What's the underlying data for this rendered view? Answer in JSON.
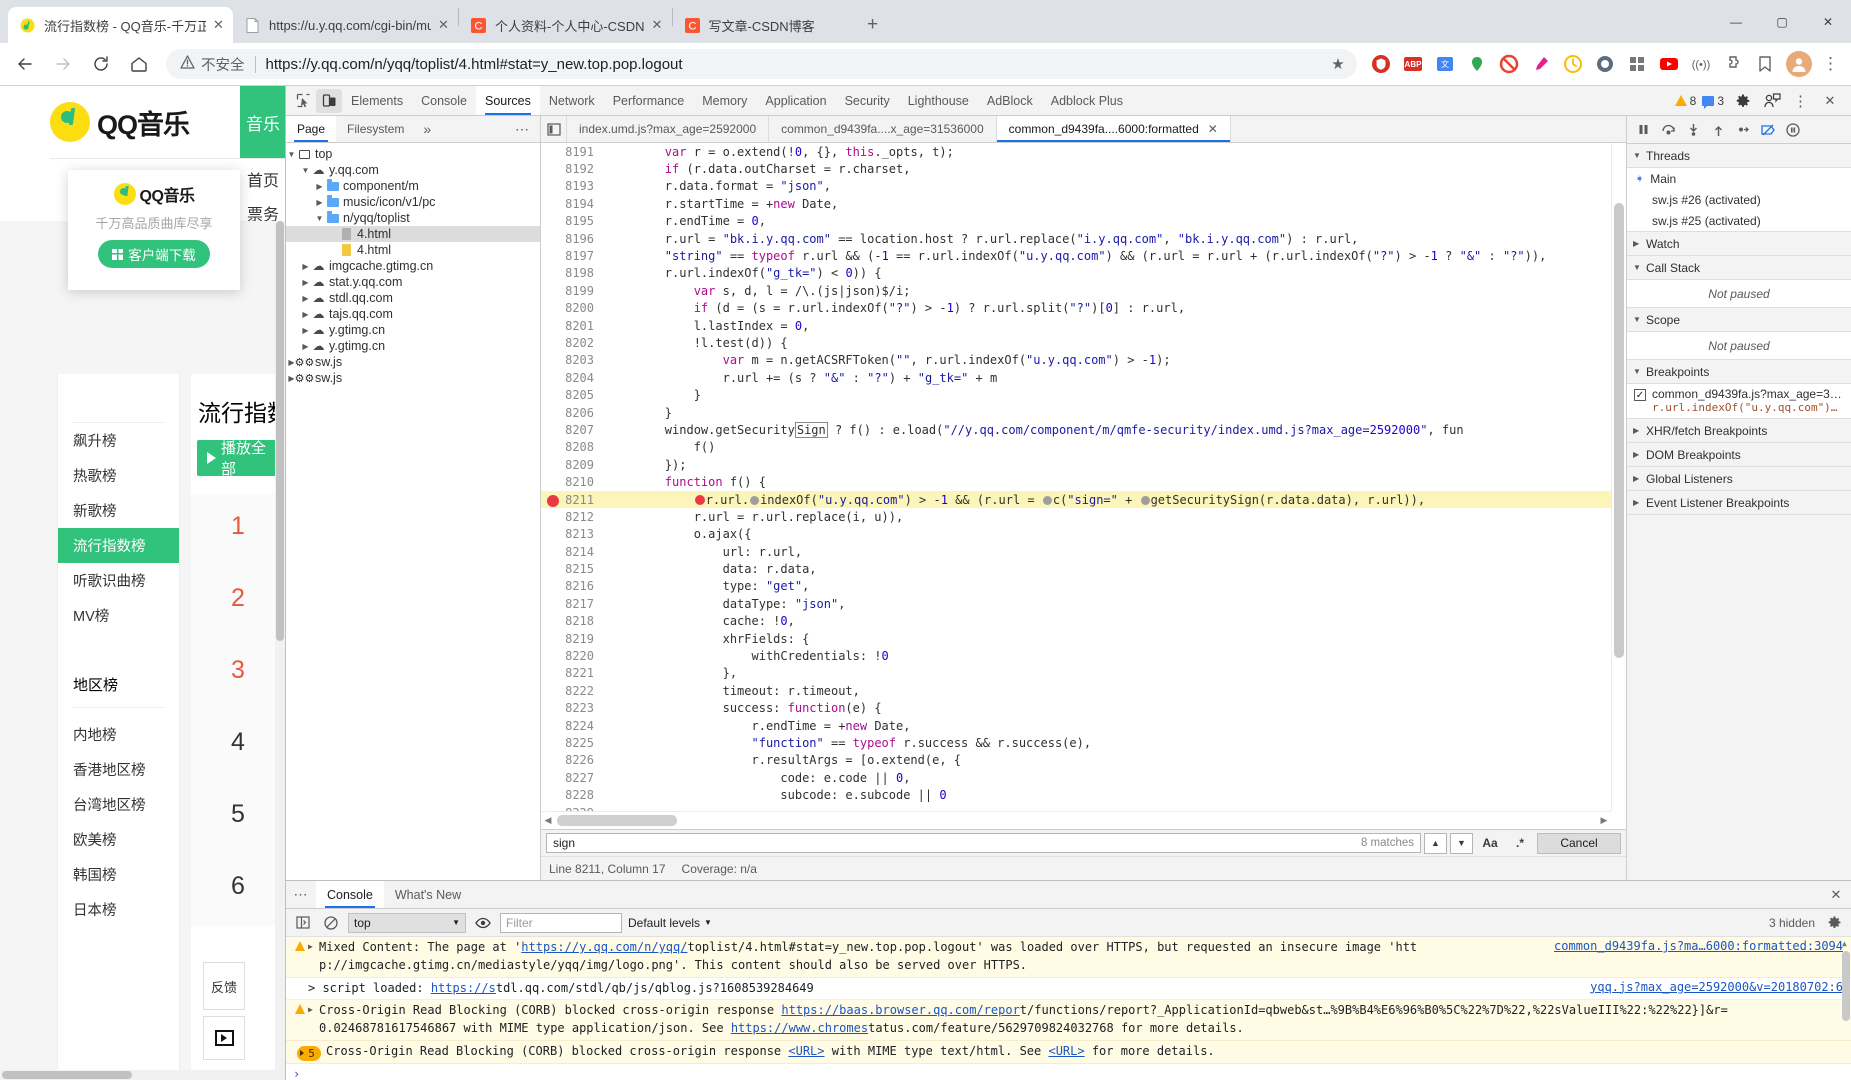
{
  "browser": {
    "tabs": [
      {
        "title": "流行指数榜 - QQ音乐-千万正版音",
        "favicon": "qq-music-icon",
        "active": true
      },
      {
        "title": "https://u.y.qq.com/cgi-bin/music",
        "favicon": "page-icon",
        "active": false
      },
      {
        "title": "个人资料-个人中心-CSDN",
        "favicon": "csdn-icon",
        "active": false
      },
      {
        "title": "写文章-CSDN博客",
        "favicon": "csdn-icon",
        "active": false
      }
    ],
    "new_tab_label": "+",
    "window_controls": {
      "minimize": "—",
      "maximize": "▢",
      "close": "✕"
    },
    "nav": {
      "back": "←",
      "forward": "→",
      "reload": "↻",
      "home": "⌂"
    },
    "omnibox": {
      "security_label": "不安全",
      "security_icon": "warning-triangle-icon",
      "url": "https://y.qq.com/n/yqq/toplist/4.html#stat=y_new.top.pop.logout",
      "star_icon": "★"
    },
    "extensions": [
      "shield-icon",
      "abp-icon",
      "translate-icon",
      "tracker-icon",
      "adblock-icon",
      "eyedropper-icon",
      "clock-icon",
      "grammar-icon",
      "grid-icon",
      "youtube-icon",
      "wifi-icon",
      "puzzle-icon",
      "bookmark-icon"
    ],
    "avatar": "user-avatar",
    "menu": "⋮"
  },
  "page": {
    "logo_text": "QQ音乐",
    "green_tab": "音乐",
    "nav_items": [
      "首页",
      "票务"
    ],
    "popup": {
      "logo_text": "QQ音乐",
      "tagline": "千万高品质曲库尽享",
      "button": "客户端下载"
    },
    "ranks_primary": [
      "飙升榜",
      "热歌榜",
      "新歌榜",
      "流行指数榜",
      "听歌识曲榜",
      "MV榜"
    ],
    "selected_rank": "流行指数榜",
    "ranks_region_title": "地区榜",
    "ranks_region": [
      "内地榜",
      "香港地区榜",
      "台湾地区榜",
      "欧美榜",
      "韩国榜",
      "日本榜"
    ],
    "list_title": "流行指数榜",
    "play_all": "播放全部",
    "song_numbers": [
      "1",
      "2",
      "3",
      "4",
      "5",
      "6"
    ],
    "feedback": "反馈",
    "player_icon": "play-box-icon"
  },
  "devtools": {
    "inspect_icon": "inspect-cursor-icon",
    "device_icon": "device-toggle-icon",
    "panels": [
      "Elements",
      "Console",
      "Sources",
      "Network",
      "Performance",
      "Memory",
      "Application",
      "Security",
      "Lighthouse",
      "AdBlock",
      "Adblock Plus"
    ],
    "active_panel": "Sources",
    "warning_count": "8",
    "message_count": "3",
    "settings_icon": "gear-icon",
    "feedback_icon": "person-feedback-icon",
    "more_icon": "⋮",
    "close_icon": "✕",
    "dock_icon": "dock-icon"
  },
  "navigator": {
    "tabs": [
      "Page",
      "Filesystem"
    ],
    "active_tab": "Page",
    "overflow": "»",
    "more": "⋯",
    "tree": [
      {
        "label": "top",
        "depth": 0,
        "icon": "frame-icon",
        "twisty": "▼",
        "selected": false
      },
      {
        "label": "y.qq.com",
        "depth": 1,
        "icon": "cloud-icon",
        "twisty": "▼",
        "selected": false
      },
      {
        "label": "component/m",
        "depth": 2,
        "icon": "folder-icon",
        "twisty": "▶",
        "selected": false
      },
      {
        "label": "music/icon/v1/pc",
        "depth": 2,
        "icon": "folder-icon",
        "twisty": "▶",
        "selected": false
      },
      {
        "label": "n/yqq/toplist",
        "depth": 2,
        "icon": "folder-icon",
        "twisty": "▼",
        "selected": false
      },
      {
        "label": "4.html",
        "depth": 3,
        "icon": "file-gray-icon",
        "twisty": "",
        "selected": true
      },
      {
        "label": "4.html",
        "depth": 3,
        "icon": "file-yellow-icon",
        "twisty": "",
        "selected": false
      },
      {
        "label": "imgcache.gtimg.cn",
        "depth": 1,
        "icon": "cloud-icon",
        "twisty": "▶",
        "selected": false
      },
      {
        "label": "stat.y.qq.com",
        "depth": 1,
        "icon": "cloud-icon",
        "twisty": "▶",
        "selected": false
      },
      {
        "label": "stdl.qq.com",
        "depth": 1,
        "icon": "cloud-icon",
        "twisty": "▶",
        "selected": false
      },
      {
        "label": "tajs.qq.com",
        "depth": 1,
        "icon": "cloud-icon",
        "twisty": "▶",
        "selected": false
      },
      {
        "label": "y.gtimg.cn",
        "depth": 1,
        "icon": "cloud-icon",
        "twisty": "▶",
        "selected": false
      },
      {
        "label": "y.gtimg.cn",
        "depth": 1,
        "icon": "cloud-icon",
        "twisty": "▶",
        "selected": false
      },
      {
        "label": "sw.js",
        "depth": 0,
        "icon": "gear-icon",
        "twisty": "▶",
        "selected": false
      },
      {
        "label": "sw.js",
        "depth": 0,
        "icon": "gear-icon",
        "twisty": "▶",
        "selected": false
      }
    ]
  },
  "editor": {
    "tabs": [
      {
        "label": "index.umd.js?max_age=2592000",
        "active": false,
        "closable": false
      },
      {
        "label": "common_d9439fa....x_age=31536000",
        "active": false,
        "closable": false
      },
      {
        "label": "common_d9439fa....6000:formatted",
        "active": true,
        "closable": true
      }
    ],
    "first_line": 8191,
    "breakpoint_line": 8211,
    "lines": [
      "        var r = o.extend(!0, {}, this._opts, t);",
      "        if (r.data.outCharset = r.charset,",
      "        r.data.format = \"json\",",
      "        r.startTime = +new Date,",
      "        r.endTime = 0,",
      "        r.url = \"bk.i.y.qq.com\" == location.host ? r.url.replace(\"i.y.qq.com\", \"bk.i.y.qq.com\") : r.url,",
      "        \"string\" == typeof r.url && (-1 == r.url.indexOf(\"u.y.qq.com\") && (r.url = r.url + (r.url.indexOf(\"?\") > -1 ? \"&\" : \"?\")),",
      "        r.url.indexOf(\"g_tk=\") < 0)) {",
      "            var s, d, l = /\\.(js|json)$/i;",
      "            if (d = (s = r.url.indexOf(\"?\") > -1) ? r.url.split(\"?\")[0] : r.url,",
      "            l.lastIndex = 0,",
      "            !l.test(d)) {",
      "                var m = n.getACSRFToken(\"\", r.url.indexOf(\"u.y.qq.com\") > -1);",
      "                r.url += (s ? \"&\" : \"?\") + \"g_tk=\" + m",
      "            }",
      "        }",
      "        window.getSecuritySign ? f() : e.load(\"//y.qq.com/component/m/qmfe-security/index.umd.js?max_age=2592000\", fun",
      "            f()",
      "        });",
      "        function f() {",
      "            r.url.indexOf(\"u.y.qq.com\") > -1 && (r.url = c(\"sign=\" + getSecuritySign(r.data.data), r.url)),",
      "            r.url = r.url.replace(i, u)),",
      "            o.ajax({",
      "                url: r.url,",
      "                data: r.data,",
      "                type: \"get\",",
      "                dataType: \"json\",",
      "                cache: !0,",
      "                xhrFields: {",
      "                    withCredentials: !0",
      "                },",
      "                timeout: r.timeout,",
      "                success: function(e) {",
      "                    r.endTime = +new Date,",
      "                    \"function\" == typeof r.success && r.success(e),",
      "                    r.resultArgs = [o.extend(e, {",
      "                        code: e.code || 0,",
      "                        subcode: e.subcode || 0",
      "                    "
    ],
    "search": {
      "query": "sign",
      "matches": "8 matches",
      "prev_icon": "▲",
      "next_icon": "▼",
      "match_case": "Aa",
      "regex": ".*",
      "cancel": "Cancel"
    },
    "status": {
      "position": "Line 8211, Column 17",
      "coverage": "Coverage: n/a"
    }
  },
  "debugger": {
    "controls": [
      "pause-icon",
      "step-over-icon",
      "step-into-icon",
      "step-out-icon",
      "step-icon",
      "deactivate-breakpoints-icon",
      "pause-on-exceptions-icon"
    ],
    "sections": [
      {
        "title": "Threads",
        "expanded": true
      },
      {
        "title": "Watch",
        "expanded": false
      },
      {
        "title": "Call Stack",
        "expanded": true,
        "empty_text": "Not paused"
      },
      {
        "title": "Scope",
        "expanded": true,
        "empty_text": "Not paused"
      },
      {
        "title": "Breakpoints",
        "expanded": true
      },
      {
        "title": "XHR/fetch Breakpoints",
        "expanded": false
      },
      {
        "title": "DOM Breakpoints",
        "expanded": false
      },
      {
        "title": "Global Listeners",
        "expanded": false
      },
      {
        "title": "Event Listener Breakpoints",
        "expanded": false
      }
    ],
    "threads": [
      {
        "label": "Main",
        "active": true
      },
      {
        "label": "sw.js #26 (activated)",
        "active": false
      },
      {
        "label": "sw.js #25 (activated)",
        "active": false
      }
    ],
    "breakpoints": [
      {
        "checked": true,
        "file": "common_d9439fa.js?max_age=3…",
        "code": "r.url.indexOf(\"u.y.qq.com\")…"
      }
    ]
  },
  "drawer": {
    "more": "⋯",
    "tabs": [
      "Console",
      "What's New"
    ],
    "active_tab": "Console",
    "close": "✕",
    "toolbar": {
      "sidebar_icon": "console-sidebar-icon",
      "clear_icon": "clear-console-icon",
      "context": "top",
      "eye_icon": "live-expression-icon",
      "filter_placeholder": "Filter",
      "levels": "Default levels",
      "hidden_count": "3 hidden",
      "settings_icon": "gear-icon"
    },
    "messages": [
      {
        "type": "warning",
        "expandable": true,
        "text": "Mixed Content: The page at 'https://y.qq.com/n/yqq/toplist/4.html#stat=y_new.top.pop.logout' was loaded over HTTPS, but requested an insecure image 'htt",
        "text2": "p://imgcache.gtimg.cn/mediastyle/yqq/img/logo.png'. This content should also be served over HTTPS.",
        "source": "common_d9439fa.js?ma…6000:formatted:3094"
      },
      {
        "type": "log",
        "expandable": false,
        "text": "> script loaded:  https://stdl.qq.com/stdl/qb/js/qblog.js?1608539284649",
        "text2": "",
        "source": "yqq.js?max_age=2592000&v=20180702:6"
      },
      {
        "type": "warning",
        "expandable": true,
        "text": "Cross-Origin Read Blocking (CORB) blocked cross-origin response https://baas.browser.qq.com/report/functions/report?_ApplicationId=qbweb&st…%9B%B4%E6%96%B0%5C%22%7D%22,%22sValueIII%22:%22%22}]&r=",
        "text2": "0.02468781617546867 with MIME type application/json. See https://www.chromestatus.com/feature/5629709824032768 for more details.",
        "source": ""
      },
      {
        "type": "grouped",
        "count": "5",
        "expandable": true,
        "text": "Cross-Origin Read Blocking (CORB) blocked cross-origin response <URL> with MIME type text/html. See <URL> for more details.",
        "text2": "",
        "source": ""
      }
    ],
    "prompt": "›"
  },
  "colors": {
    "accent": "#1a73e8",
    "qq_green": "#31c27c",
    "qq_yellow": "#fcdd11",
    "warning": "#f9ab00",
    "breakpoint": "#eb3941",
    "highlight": "#fbf5b9"
  }
}
